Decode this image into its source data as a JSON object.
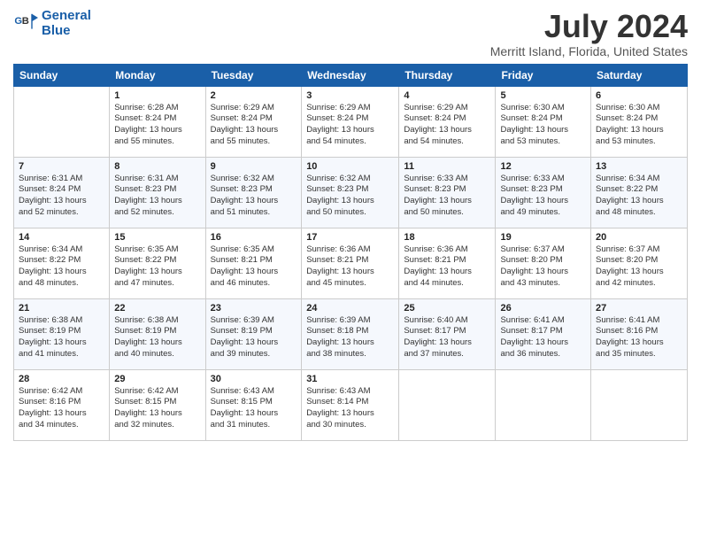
{
  "logo": {
    "line1": "General",
    "line2": "Blue"
  },
  "title": "July 2024",
  "subtitle": "Merritt Island, Florida, United States",
  "days_of_week": [
    "Sunday",
    "Monday",
    "Tuesday",
    "Wednesday",
    "Thursday",
    "Friday",
    "Saturday"
  ],
  "weeks": [
    [
      {
        "day": "",
        "info": ""
      },
      {
        "day": "1",
        "info": "Sunrise: 6:28 AM\nSunset: 8:24 PM\nDaylight: 13 hours\nand 55 minutes."
      },
      {
        "day": "2",
        "info": "Sunrise: 6:29 AM\nSunset: 8:24 PM\nDaylight: 13 hours\nand 55 minutes."
      },
      {
        "day": "3",
        "info": "Sunrise: 6:29 AM\nSunset: 8:24 PM\nDaylight: 13 hours\nand 54 minutes."
      },
      {
        "day": "4",
        "info": "Sunrise: 6:29 AM\nSunset: 8:24 PM\nDaylight: 13 hours\nand 54 minutes."
      },
      {
        "day": "5",
        "info": "Sunrise: 6:30 AM\nSunset: 8:24 PM\nDaylight: 13 hours\nand 53 minutes."
      },
      {
        "day": "6",
        "info": "Sunrise: 6:30 AM\nSunset: 8:24 PM\nDaylight: 13 hours\nand 53 minutes."
      }
    ],
    [
      {
        "day": "7",
        "info": "Sunrise: 6:31 AM\nSunset: 8:24 PM\nDaylight: 13 hours\nand 52 minutes."
      },
      {
        "day": "8",
        "info": "Sunrise: 6:31 AM\nSunset: 8:23 PM\nDaylight: 13 hours\nand 52 minutes."
      },
      {
        "day": "9",
        "info": "Sunrise: 6:32 AM\nSunset: 8:23 PM\nDaylight: 13 hours\nand 51 minutes."
      },
      {
        "day": "10",
        "info": "Sunrise: 6:32 AM\nSunset: 8:23 PM\nDaylight: 13 hours\nand 50 minutes."
      },
      {
        "day": "11",
        "info": "Sunrise: 6:33 AM\nSunset: 8:23 PM\nDaylight: 13 hours\nand 50 minutes."
      },
      {
        "day": "12",
        "info": "Sunrise: 6:33 AM\nSunset: 8:23 PM\nDaylight: 13 hours\nand 49 minutes."
      },
      {
        "day": "13",
        "info": "Sunrise: 6:34 AM\nSunset: 8:22 PM\nDaylight: 13 hours\nand 48 minutes."
      }
    ],
    [
      {
        "day": "14",
        "info": "Sunrise: 6:34 AM\nSunset: 8:22 PM\nDaylight: 13 hours\nand 48 minutes."
      },
      {
        "day": "15",
        "info": "Sunrise: 6:35 AM\nSunset: 8:22 PM\nDaylight: 13 hours\nand 47 minutes."
      },
      {
        "day": "16",
        "info": "Sunrise: 6:35 AM\nSunset: 8:21 PM\nDaylight: 13 hours\nand 46 minutes."
      },
      {
        "day": "17",
        "info": "Sunrise: 6:36 AM\nSunset: 8:21 PM\nDaylight: 13 hours\nand 45 minutes."
      },
      {
        "day": "18",
        "info": "Sunrise: 6:36 AM\nSunset: 8:21 PM\nDaylight: 13 hours\nand 44 minutes."
      },
      {
        "day": "19",
        "info": "Sunrise: 6:37 AM\nSunset: 8:20 PM\nDaylight: 13 hours\nand 43 minutes."
      },
      {
        "day": "20",
        "info": "Sunrise: 6:37 AM\nSunset: 8:20 PM\nDaylight: 13 hours\nand 42 minutes."
      }
    ],
    [
      {
        "day": "21",
        "info": "Sunrise: 6:38 AM\nSunset: 8:19 PM\nDaylight: 13 hours\nand 41 minutes."
      },
      {
        "day": "22",
        "info": "Sunrise: 6:38 AM\nSunset: 8:19 PM\nDaylight: 13 hours\nand 40 minutes."
      },
      {
        "day": "23",
        "info": "Sunrise: 6:39 AM\nSunset: 8:19 PM\nDaylight: 13 hours\nand 39 minutes."
      },
      {
        "day": "24",
        "info": "Sunrise: 6:39 AM\nSunset: 8:18 PM\nDaylight: 13 hours\nand 38 minutes."
      },
      {
        "day": "25",
        "info": "Sunrise: 6:40 AM\nSunset: 8:17 PM\nDaylight: 13 hours\nand 37 minutes."
      },
      {
        "day": "26",
        "info": "Sunrise: 6:41 AM\nSunset: 8:17 PM\nDaylight: 13 hours\nand 36 minutes."
      },
      {
        "day": "27",
        "info": "Sunrise: 6:41 AM\nSunset: 8:16 PM\nDaylight: 13 hours\nand 35 minutes."
      }
    ],
    [
      {
        "day": "28",
        "info": "Sunrise: 6:42 AM\nSunset: 8:16 PM\nDaylight: 13 hours\nand 34 minutes."
      },
      {
        "day": "29",
        "info": "Sunrise: 6:42 AM\nSunset: 8:15 PM\nDaylight: 13 hours\nand 32 minutes."
      },
      {
        "day": "30",
        "info": "Sunrise: 6:43 AM\nSunset: 8:15 PM\nDaylight: 13 hours\nand 31 minutes."
      },
      {
        "day": "31",
        "info": "Sunrise: 6:43 AM\nSunset: 8:14 PM\nDaylight: 13 hours\nand 30 minutes."
      },
      {
        "day": "",
        "info": ""
      },
      {
        "day": "",
        "info": ""
      },
      {
        "day": "",
        "info": ""
      }
    ]
  ]
}
